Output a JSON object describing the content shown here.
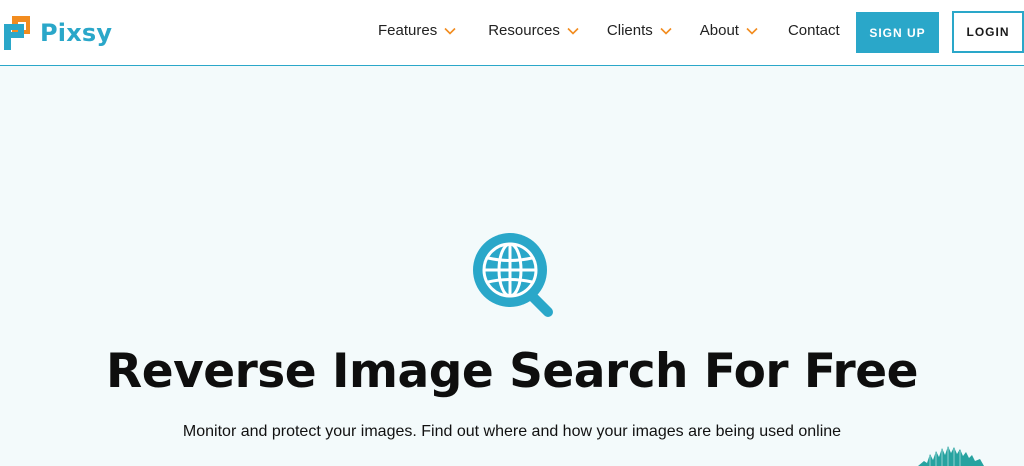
{
  "brand": {
    "name": "Pixsy",
    "accent": "#2aa7c9",
    "logo_orange": "#f28c1f"
  },
  "nav": {
    "items": [
      {
        "label": "Features",
        "has_dropdown": true
      },
      {
        "label": "Resources",
        "has_dropdown": true
      },
      {
        "label": "Clients",
        "has_dropdown": true
      },
      {
        "label": "About",
        "has_dropdown": true
      },
      {
        "label": "Contact",
        "has_dropdown": false
      }
    ],
    "signup_label": "SIGN UP",
    "login_label": "LOGIN"
  },
  "hero": {
    "icon": "globe-search-icon",
    "title": "Reverse Image Search For Free",
    "subtitle": "Monitor and protect your images. Find out where and how your images are being used online"
  }
}
